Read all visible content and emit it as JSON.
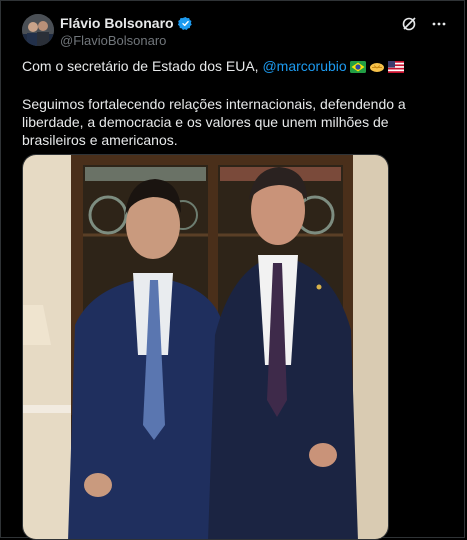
{
  "author": {
    "display_name": "Flávio Bolsonaro",
    "handle": "@FlavioBolsonaro",
    "avatar_icon": "profile-photo",
    "verified_icon": "verified-badge-icon"
  },
  "actions": {
    "grok_icon": "grok-icon",
    "more_icon": "more-icon"
  },
  "tweet": {
    "line1_prefix": "Com o secretário de Estado dos EUA, ",
    "mention": "@marcorubio",
    "emojis": [
      "brazil-flag",
      "handshake",
      "us-flag"
    ],
    "paragraph2": "Seguimos fortalecendo relações internacionais, defendendo a liberdade, a democracia e os valores que unem milhões de brasileiros e americanos."
  },
  "media": {
    "kind": "photo",
    "description_icon": "photo-two-men-in-suits"
  },
  "colors": {
    "background": "#000000",
    "text": "#e7e9ea",
    "secondary_text": "#71767b",
    "link": "#1d9bf0",
    "verified": "#1d9bf0",
    "border": "#2f3336"
  }
}
